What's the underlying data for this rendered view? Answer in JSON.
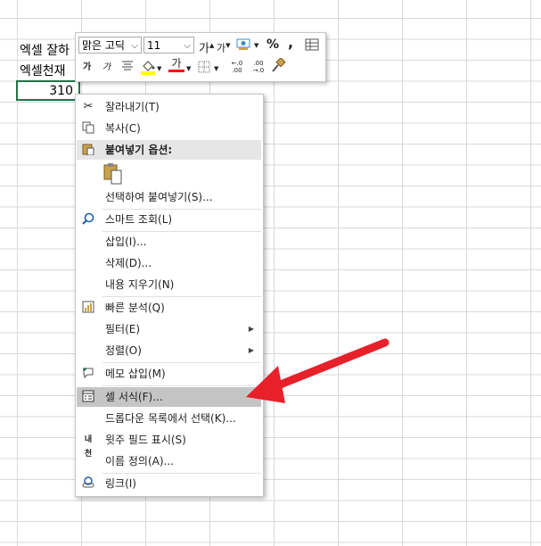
{
  "cells": {
    "a1": "엑셀 잘하",
    "a2": "엑셀천재",
    "a3": "310"
  },
  "mini_toolbar": {
    "font_name": "맑은 고딕",
    "font_size": "11",
    "grow_font": "가",
    "shrink_font": "가",
    "percent": "%",
    "comma": ",",
    "bold": "가",
    "italic": "가",
    "font_color_glyph": "가",
    "dec_increase": "←.0 .00",
    "dec_decrease": ".00 →.0"
  },
  "menu": {
    "cut": "잘라내기(T)",
    "copy": "복사(C)",
    "paste_options": "붙여넣기 옵션:",
    "paste_special": "선택하여 붙여넣기(S)...",
    "smart_lookup": "스마트 조회(L)",
    "insert": "삽입(I)...",
    "delete": "삭제(D)...",
    "clear": "내용 지우기(N)",
    "quick_analysis": "빠른 분석(Q)",
    "filter": "필터(E)",
    "sort": "정렬(O)",
    "insert_comment": "메모 삽입(M)",
    "format_cells": "셀 서식(F)...",
    "dropdown_pick": "드롭다운 목록에서 선택(K)...",
    "phonetic": "윗주 필드 표시(S)",
    "define_name": "이름 정의(A)...",
    "link": "링크(I)"
  },
  "icons": {
    "phonetic_glyph": "내천"
  },
  "colors": {
    "selection": "#217346",
    "highlight": "#c5c5c5",
    "arrow": "#e8202a",
    "fill_yellow": "#ffff00",
    "font_red": "#ff0000"
  }
}
